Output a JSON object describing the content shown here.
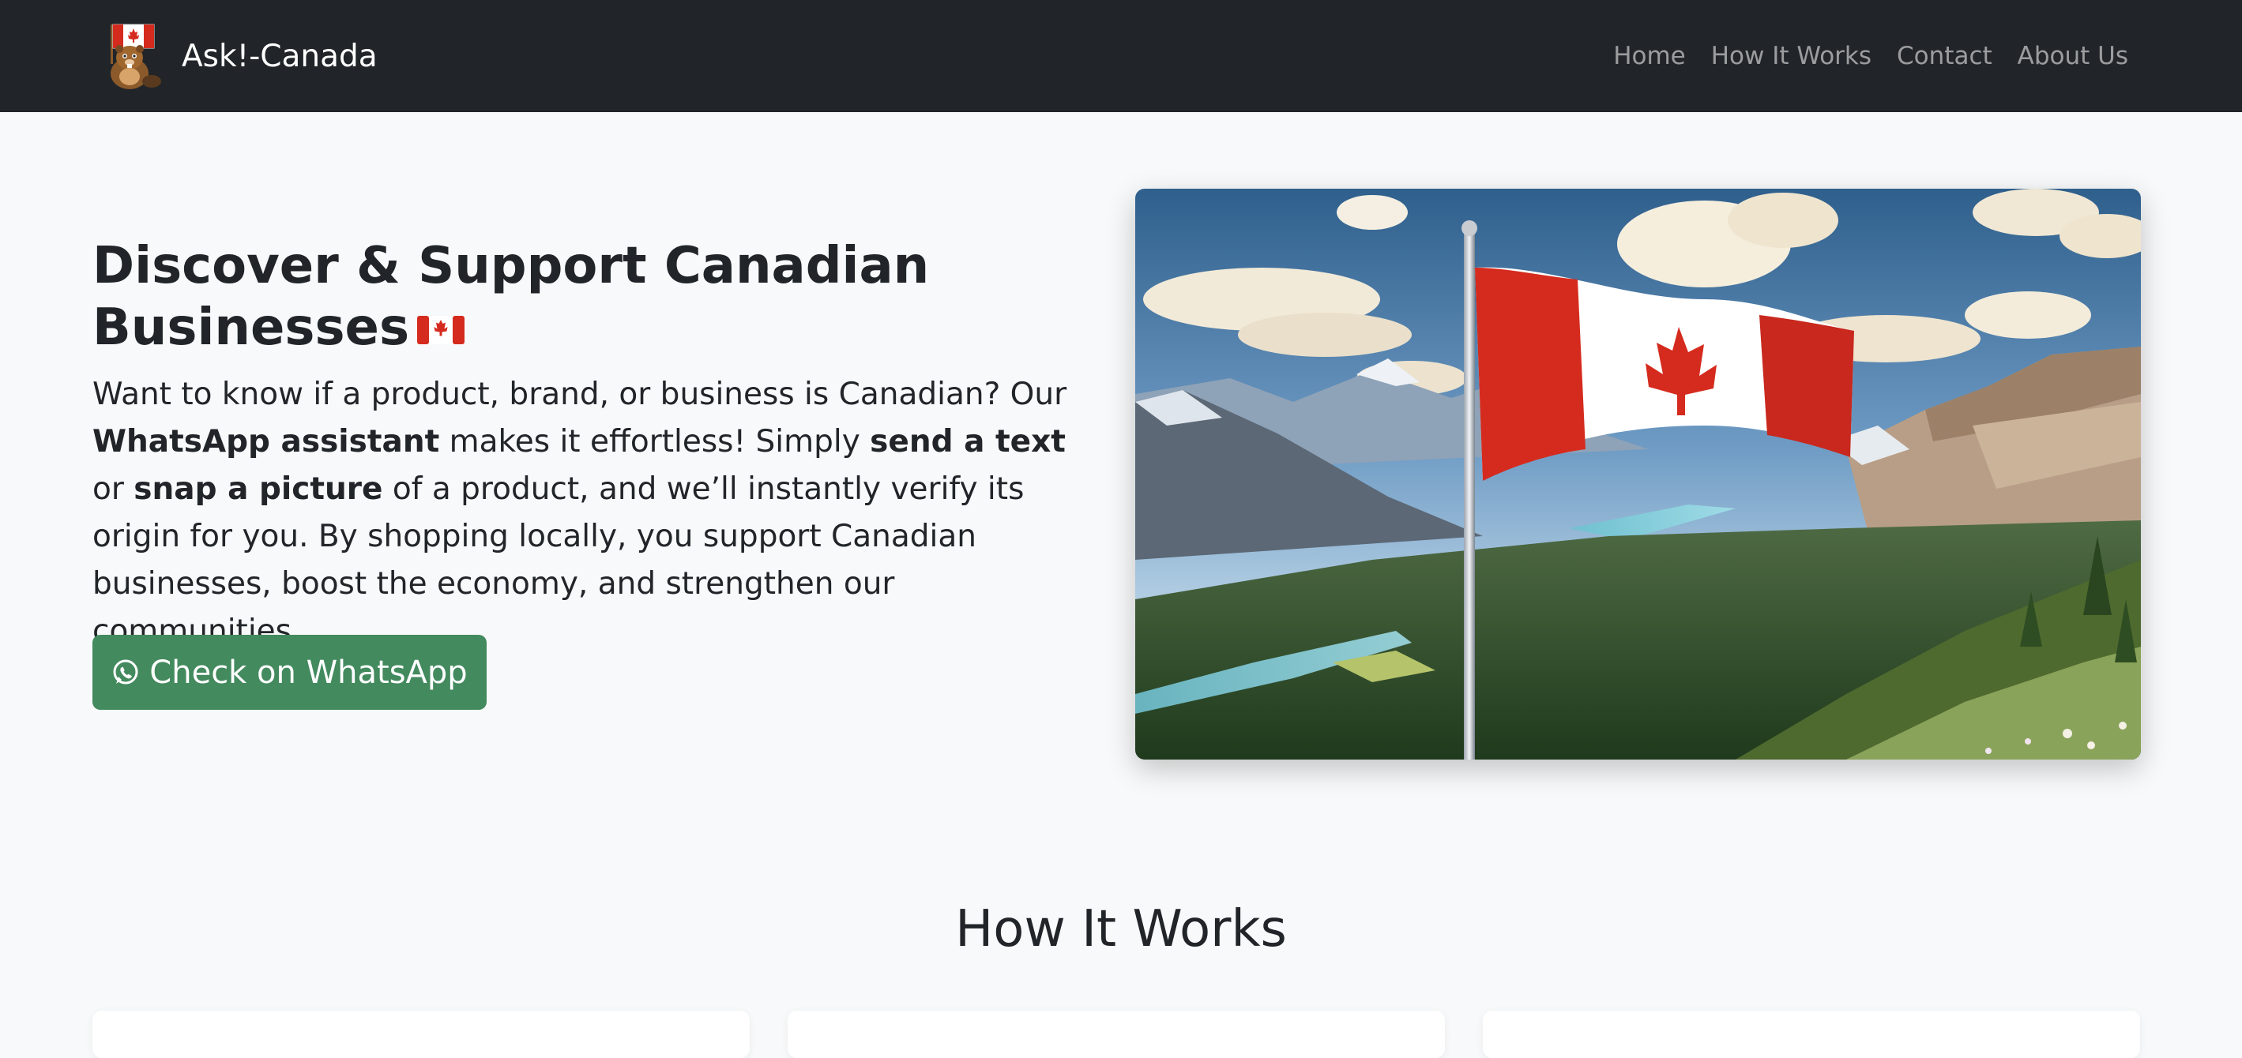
{
  "navbar": {
    "brand_name": "Ask!-Canada",
    "logo_icon": "beaver-flag-logo-icon",
    "links": [
      {
        "label": "Home"
      },
      {
        "label": "How It Works"
      },
      {
        "label": "Contact"
      },
      {
        "label": "About Us"
      }
    ]
  },
  "hero": {
    "title": "Discover & Support Canadian Businesses",
    "title_icon": "canada-flag-icon",
    "description": {
      "p1": "Want to know if a product, brand, or business is Canadian? Our ",
      "b1": "WhatsApp assistant",
      "p2": " makes it effortless! Simply ",
      "b2": "send a text",
      "p3": " or ",
      "b3": "snap a picture",
      "p4": " of a product, and we’ll instantly verify its origin for you. By shopping locally, you support Canadian businesses, boost the economy, and strengthen our communities."
    },
    "cta_label": "Check on WhatsApp",
    "cta_icon": "whatsapp-icon",
    "image": "canadian-flag-mountains-image"
  },
  "how_it_works": {
    "title": "How It Works"
  },
  "colors": {
    "navbar_bg": "#212529",
    "page_bg": "#f8f9fa",
    "cta_bg": "#438a5e",
    "canada_red": "#d52b1e"
  }
}
